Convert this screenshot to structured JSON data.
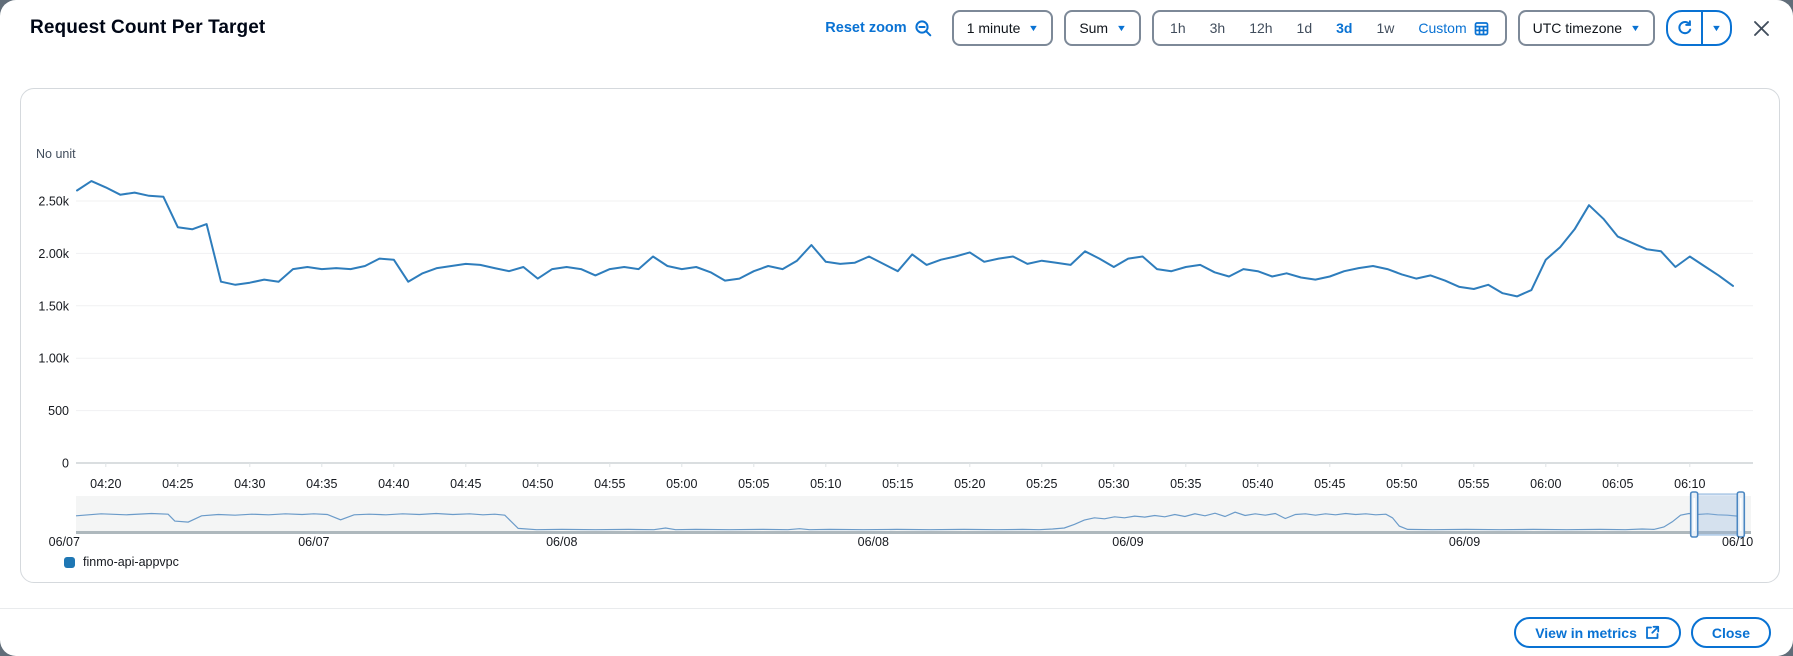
{
  "modal": {
    "title": "Request Count Per Target"
  },
  "toolbar": {
    "reset_zoom_label": "Reset zoom",
    "period_dropdown": "1 minute",
    "statistic_dropdown": "Sum",
    "ranges": [
      "1h",
      "3h",
      "12h",
      "1d",
      "3d",
      "1w"
    ],
    "selected_range": "3d",
    "custom_label": "Custom",
    "timezone_dropdown": "UTC timezone"
  },
  "footer": {
    "view_in_metrics_label": "View in metrics",
    "close_label": "Close"
  },
  "legend": [
    {
      "label": "finmo-api-appvpc",
      "color": "#1f77b4"
    }
  ],
  "colors": {
    "accent": "#0972d3",
    "line": "#2e7dbc",
    "mini_line": "#6b9bc9",
    "grid": "#f0f1f2",
    "axis": "#cdd3d6",
    "mini_baseline": "#aeb8bd",
    "text": "#16191f",
    "brush_border": "#4b87c2",
    "brush_fill": "rgba(141,180,221,0.3)"
  },
  "chart_data": {
    "type": "line",
    "unit_label": "No unit",
    "period": "1 minute",
    "statistic": "Sum",
    "x_start_time": "04:18",
    "x_minutes_per_point": 1,
    "series": [
      {
        "name": "finmo-api-appvpc",
        "values": [
          2600,
          2690,
          2630,
          2560,
          2580,
          2550,
          2540,
          2250,
          2230,
          2280,
          1730,
          1700,
          1720,
          1750,
          1730,
          1850,
          1870,
          1850,
          1860,
          1850,
          1880,
          1950,
          1940,
          1730,
          1810,
          1860,
          1880,
          1900,
          1890,
          1860,
          1830,
          1870,
          1760,
          1850,
          1870,
          1850,
          1790,
          1850,
          1870,
          1850,
          1970,
          1880,
          1850,
          1870,
          1820,
          1740,
          1760,
          1830,
          1880,
          1850,
          1930,
          2080,
          1920,
          1900,
          1910,
          1970,
          1900,
          1830,
          1990,
          1890,
          1940,
          1970,
          2010,
          1920,
          1950,
          1970,
          1900,
          1930,
          1910,
          1890,
          2020,
          1950,
          1870,
          1950,
          1970,
          1850,
          1830,
          1870,
          1890,
          1820,
          1780,
          1850,
          1830,
          1780,
          1810,
          1770,
          1750,
          1780,
          1830,
          1860,
          1880,
          1850,
          1800,
          1760,
          1790,
          1740,
          1680,
          1660,
          1700,
          1620,
          1590,
          1650,
          1940,
          2060,
          2230,
          2460,
          2330,
          2160,
          2100,
          2040,
          2020,
          1870,
          1970,
          1880,
          1790,
          1690
        ]
      }
    ],
    "ylim": [
      0,
      2700
    ],
    "y_ticks": [
      {
        "label": "0",
        "value": 0
      },
      {
        "label": "500",
        "value": 500
      },
      {
        "label": "1.00k",
        "value": 1000
      },
      {
        "label": "1.50k",
        "value": 1500
      },
      {
        "label": "2.00k",
        "value": 2000
      },
      {
        "label": "2.50k",
        "value": 2500
      }
    ],
    "x_ticks": [
      "04:20",
      "04:25",
      "04:30",
      "04:35",
      "04:40",
      "04:45",
      "04:50",
      "04:55",
      "05:00",
      "05:05",
      "05:10",
      "05:15",
      "05:20",
      "05:25",
      "05:30",
      "05:35",
      "05:40",
      "05:45",
      "05:50",
      "05:55",
      "06:00",
      "06:05",
      "06:10"
    ],
    "first_tick_offset_min": 2,
    "tick_interval_min": 5,
    "timeline": {
      "description": "3-day overview sparkline (normalized %)",
      "date_labels": [
        {
          "label": "06/07",
          "x_pct": -0.7
        },
        {
          "label": "06/07",
          "x_pct": 14.2
        },
        {
          "label": "06/08",
          "x_pct": 29.0
        },
        {
          "label": "06/08",
          "x_pct": 47.6
        },
        {
          "label": "06/09",
          "x_pct": 62.8
        },
        {
          "label": "06/09",
          "x_pct": 82.9
        },
        {
          "label": "06/10",
          "x_pct": 99.2
        }
      ],
      "points": [
        [
          0,
          46
        ],
        [
          1.5,
          52
        ],
        [
          3,
          49
        ],
        [
          4.5,
          53
        ],
        [
          5.5,
          51
        ],
        [
          5.9,
          30
        ],
        [
          6.7,
          27
        ],
        [
          7.5,
          46
        ],
        [
          8.5,
          50
        ],
        [
          9.5,
          48
        ],
        [
          10.5,
          51
        ],
        [
          11.5,
          49
        ],
        [
          12.5,
          52
        ],
        [
          13.5,
          50
        ],
        [
          14.2,
          52
        ],
        [
          15,
          50
        ],
        [
          15.8,
          34
        ],
        [
          16.6,
          49
        ],
        [
          17.5,
          51
        ],
        [
          18.5,
          49
        ],
        [
          19.5,
          52
        ],
        [
          20.5,
          50
        ],
        [
          21.5,
          53
        ],
        [
          22.5,
          50
        ],
        [
          23.5,
          52
        ],
        [
          24.3,
          49
        ],
        [
          25,
          51
        ],
        [
          25.6,
          48
        ],
        [
          26,
          28
        ],
        [
          26.4,
          8
        ],
        [
          27.5,
          4
        ],
        [
          29,
          5
        ],
        [
          31,
          4
        ],
        [
          33,
          5
        ],
        [
          34.5,
          4
        ],
        [
          35.2,
          9
        ],
        [
          35.8,
          4
        ],
        [
          37,
          5
        ],
        [
          39,
          4
        ],
        [
          41,
          5
        ],
        [
          42.5,
          4
        ],
        [
          43.2,
          7
        ],
        [
          43.8,
          4
        ],
        [
          45,
          5
        ],
        [
          47,
          4
        ],
        [
          49,
          5
        ],
        [
          51,
          4
        ],
        [
          53,
          5
        ],
        [
          55,
          4
        ],
        [
          56.5,
          5
        ],
        [
          57.5,
          4
        ],
        [
          58.3,
          6
        ],
        [
          59,
          9
        ],
        [
          59.6,
          20
        ],
        [
          60.2,
          33
        ],
        [
          60.8,
          40
        ],
        [
          61.4,
          37
        ],
        [
          62,
          43
        ],
        [
          62.6,
          40
        ],
        [
          63.2,
          45
        ],
        [
          63.8,
          42
        ],
        [
          64.4,
          47
        ],
        [
          65,
          43
        ],
        [
          65.6,
          50
        ],
        [
          66.2,
          44
        ],
        [
          66.8,
          52
        ],
        [
          67.4,
          46
        ],
        [
          68,
          54
        ],
        [
          68.6,
          44
        ],
        [
          69.2,
          57
        ],
        [
          69.8,
          47
        ],
        [
          70.4,
          52
        ],
        [
          71,
          48
        ],
        [
          71.6,
          53
        ],
        [
          72.2,
          38
        ],
        [
          72.8,
          50
        ],
        [
          73.4,
          52
        ],
        [
          74,
          48
        ],
        [
          74.6,
          52
        ],
        [
          75.2,
          49
        ],
        [
          75.8,
          53
        ],
        [
          76.4,
          50
        ],
        [
          77,
          52
        ],
        [
          77.6,
          49
        ],
        [
          78.2,
          51
        ],
        [
          78.6,
          40
        ],
        [
          79,
          15
        ],
        [
          79.5,
          5
        ],
        [
          81,
          4
        ],
        [
          83,
          5
        ],
        [
          85,
          4
        ],
        [
          87,
          5
        ],
        [
          89,
          4
        ],
        [
          91,
          5
        ],
        [
          92.5,
          4
        ],
        [
          93.5,
          6
        ],
        [
          94.2,
          5
        ],
        [
          94.8,
          12
        ],
        [
          95.3,
          28
        ],
        [
          95.8,
          48
        ],
        [
          96.3,
          53
        ],
        [
          96.8,
          50
        ],
        [
          97.4,
          52
        ],
        [
          98,
          49
        ],
        [
          98.6,
          48
        ],
        [
          99.2,
          45
        ],
        [
          99.6,
          38
        ]
      ],
      "brush": {
        "start_pct": 96.4,
        "end_pct": 99.6
      }
    }
  }
}
